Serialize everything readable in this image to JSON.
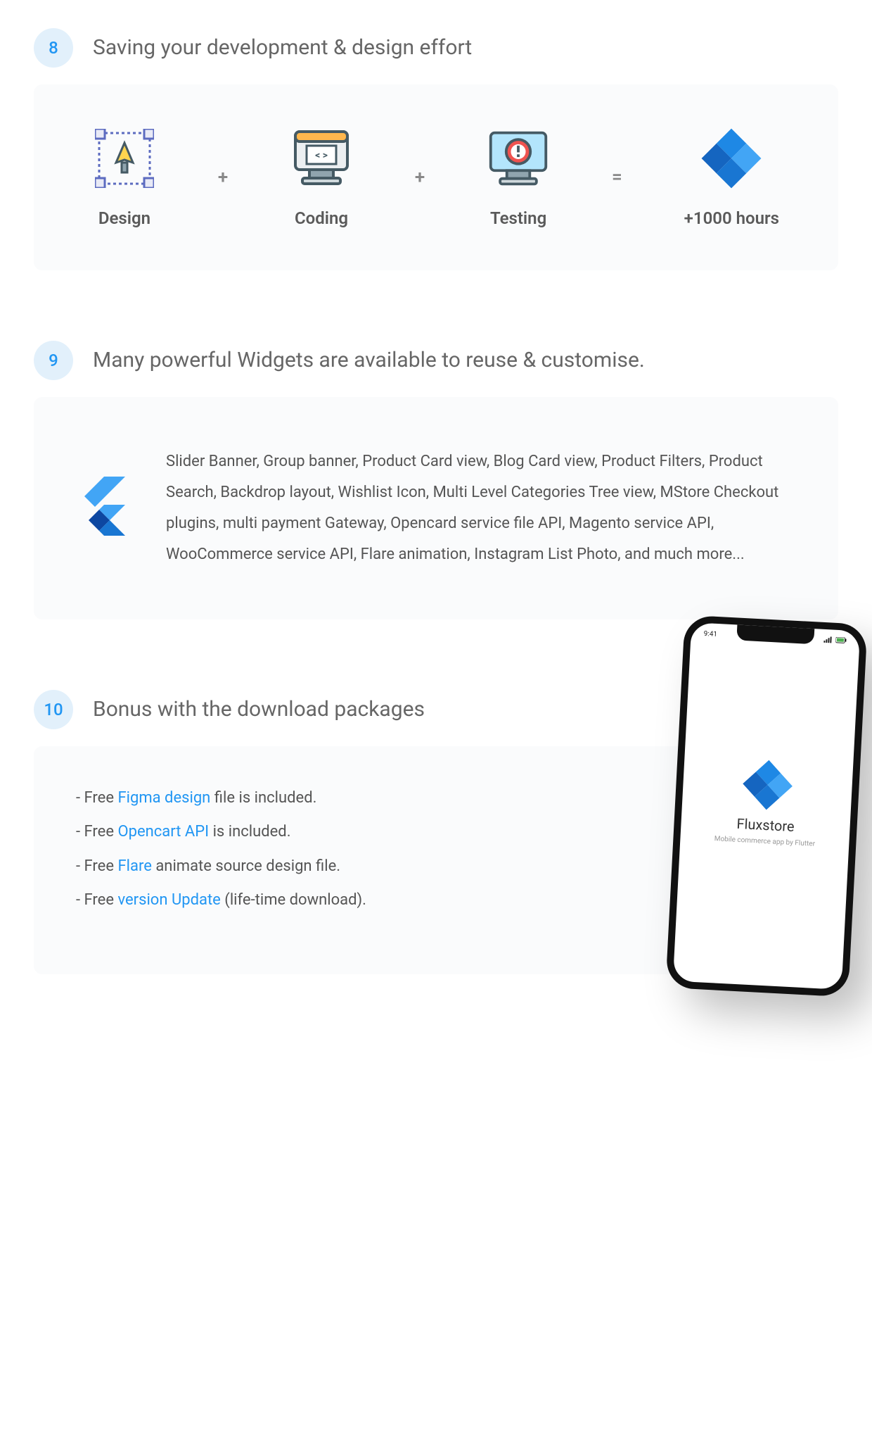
{
  "section8": {
    "number": "8",
    "title": "Saving your development & design effort",
    "items": [
      "Design",
      "Coding",
      "Testing"
    ],
    "result": "+1000 hours",
    "plus": "+",
    "equals": "="
  },
  "section9": {
    "number": "9",
    "title": "Many powerful Widgets are available to reuse & customise.",
    "body": "Slider Banner, Group banner, Product Card view, Blog Card view, Product Filters, Product Search, Backdrop layout, Wishlist Icon, Multi Level  Categories Tree view, MStore Checkout plugins, multi payment Gateway, Opencard service file API, Magento service API, WooCommerce service API, Flare animation, Instagram List Photo, and much more..."
  },
  "section10": {
    "number": "10",
    "title": "Bonus with the download packages",
    "lines": [
      {
        "pre": "- Free ",
        "hl": "Figma design",
        "post": " file is included."
      },
      {
        "pre": "- Free ",
        "hl": "Opencart API",
        "post": " is included."
      },
      {
        "pre": "- Free ",
        "hl": "Flare",
        "post": " animate source design file."
      },
      {
        "pre": "- Free ",
        "hl": "version Update",
        "post": " (life-time download)."
      }
    ],
    "phone": {
      "time": "9:41",
      "app": "Fluxstore",
      "tagline": "Mobile commerce app by Flutter"
    }
  }
}
